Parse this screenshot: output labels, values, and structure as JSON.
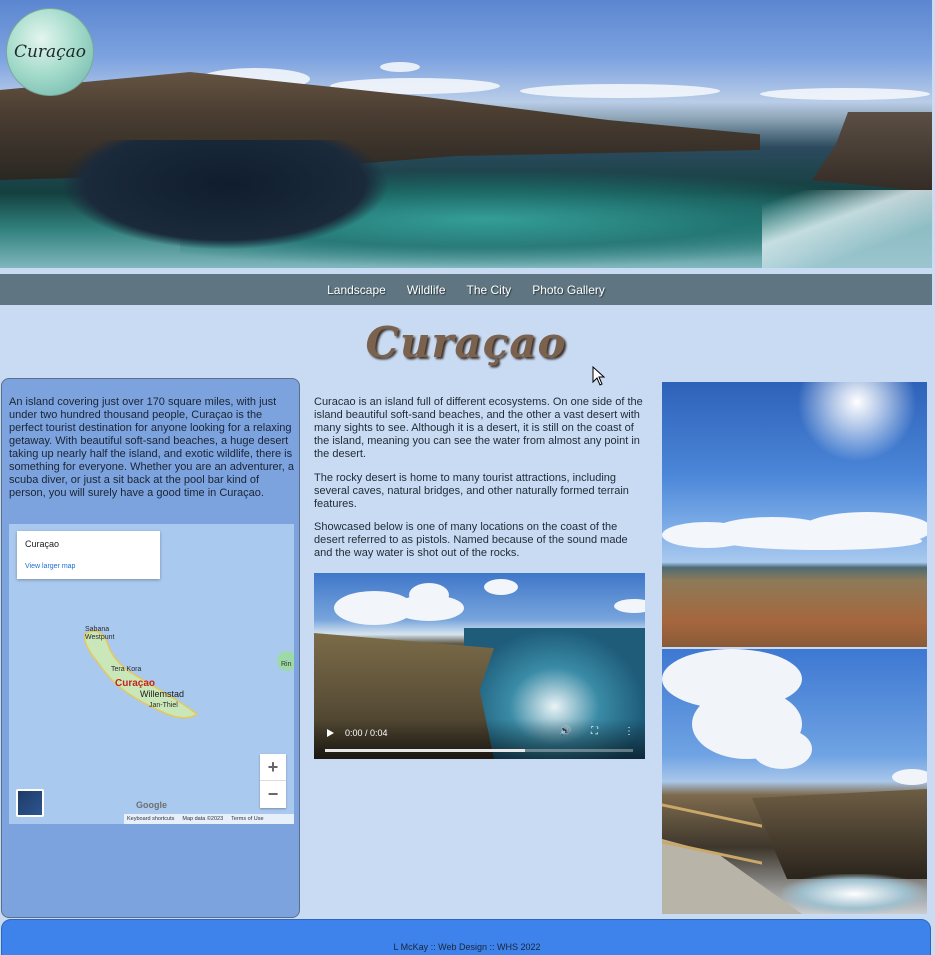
{
  "logo": {
    "text": "Curaçao"
  },
  "nav": {
    "items": [
      "Landscape",
      "Wildlife",
      "The City",
      "Photo Gallery"
    ]
  },
  "page": {
    "title": "Curaçao"
  },
  "left": {
    "intro": "An island covering just over 170 square miles, with just under two hundred thousand people, Curaçao is the perfect tourist destination for anyone looking for a relaxing getaway. With beautiful soft-sand beaches, a huge desert taking up nearly half the island, and exotic wildlife, there is something for everyone. Whether you are an adventurer, a scuba diver, or just a sit back at the pool bar kind of person, you will surely have a good time in Curaçao."
  },
  "map": {
    "card_title": "Curaçao",
    "card_link": "View larger map",
    "labels": {
      "sabana": "Sabana\nWestpunt",
      "tera_kora": "Tera Kora",
      "curacao": "Curaçao",
      "willemstad": "Willemstad",
      "jan_thiel": "Jan-Thiel",
      "rin": "Rin"
    },
    "zoom_in": "+",
    "zoom_out": "−",
    "google": "Google",
    "footer": [
      "Keyboard shortcuts",
      "Map data ©2023",
      "Terms of Use"
    ]
  },
  "middle": {
    "p1": "Curacao is an island full of different ecosystems. On one side of the island beautiful soft-sand beaches, and the other a vast desert with many sights to see. Although it is a desert, it is still on the coast of the island, meaning you can see the water from almost any point in the desert.",
    "p2": "The rocky desert is home to many tourist attractions, including several caves, natural bridges, and other naturally formed terrain features.",
    "p3": "Showcased below is one of many locations on the coast of the desert referred to as pistols. Named because of the sound made and the way water is shot out of the rocks."
  },
  "video": {
    "time": "0:00 / 0:04",
    "progress": 0.65
  },
  "footer": {
    "text": "L McKay :: Web Design :: WHS 2022"
  },
  "colors": {
    "background": "#c9dbf3",
    "nav": "#5f7581",
    "panel": "#7da3df",
    "footer": "#3e83ec",
    "title": "#7a624e"
  }
}
